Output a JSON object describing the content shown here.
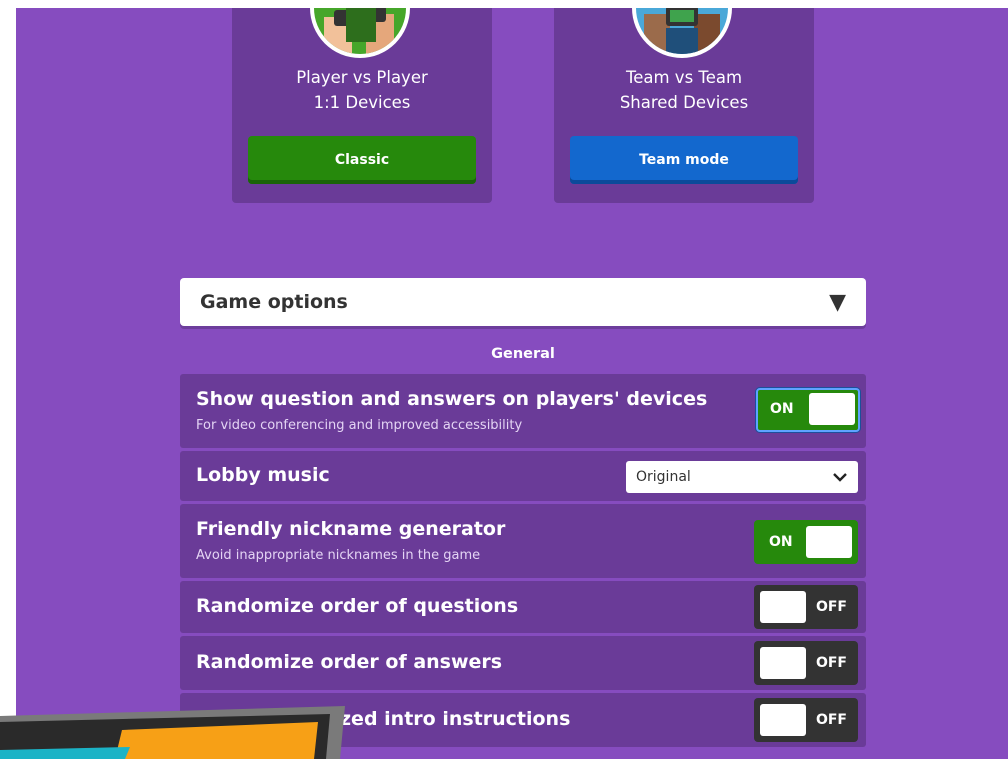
{
  "modes": [
    {
      "title": "Player vs Player",
      "subtitle": "1:1 Devices",
      "button": "Classic"
    },
    {
      "title": "Team vs Team",
      "subtitle": "Shared Devices",
      "button": "Team mode"
    }
  ],
  "options": {
    "header": "Game options",
    "caret": "▼",
    "section": "General",
    "rows": [
      {
        "label": "Show question and answers on players' devices",
        "hint": "For video conferencing and improved accessibility",
        "toggle": "ON"
      },
      {
        "label": "Lobby music",
        "select_value": "Original"
      },
      {
        "label": "Friendly nickname generator",
        "hint": "Avoid inappropriate nicknames in the game",
        "toggle": "ON"
      },
      {
        "label": "Randomize order of questions",
        "toggle": "OFF"
      },
      {
        "label": "Randomize order of answers",
        "toggle": "OFF"
      },
      {
        "label": "zed intro instructions",
        "toggle": "OFF"
      }
    ]
  },
  "colors": {
    "background": "#864cbf",
    "card": "#6a3b98",
    "classic": "#26890c",
    "team": "#1368ce",
    "toggle_on": "#26890c",
    "toggle_off": "#333333"
  }
}
